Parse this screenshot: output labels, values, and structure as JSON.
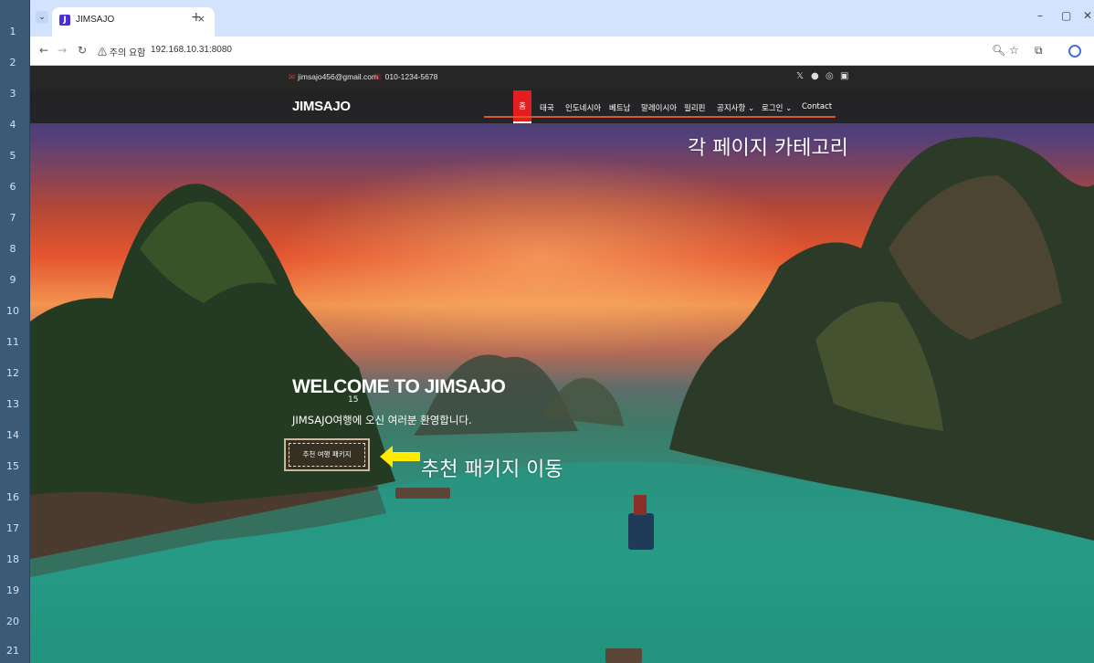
{
  "gutter": {
    "rows": [
      "1",
      "2",
      "3",
      "4",
      "5",
      "6",
      "7",
      "8",
      "9",
      "10",
      "11",
      "12",
      "13",
      "14",
      "15",
      "16",
      "17",
      "18",
      "19",
      "20",
      "21"
    ]
  },
  "browser": {
    "tab_title": "JIMSAJO",
    "tab_icon_letter": "J",
    "tab_close": "×",
    "new_tab": "+",
    "security_label": "⚠ 주의 요함",
    "url": "192.168.10.31:8080",
    "window_controls": [
      "–",
      "▢",
      "✕"
    ]
  },
  "site": {
    "topbar": {
      "email": "jimsajo456@gmail.com",
      "phone": "010-1234-5678",
      "social_icons": [
        "x-icon",
        "facebook-icon",
        "instagram-icon",
        "youtube-icon"
      ]
    },
    "navbar": {
      "brand": "JIMSAJO",
      "menu": [
        "홈",
        "태국",
        "인도네시아",
        "베트남",
        "말레이시아",
        "필리핀",
        "공지사항 ⌄",
        "로그인 ⌄",
        "Contact"
      ]
    },
    "hero": {
      "title": "WELCOME TO JIMSAJO",
      "page_number": "15",
      "subtitle": "JIMSAJO여행에 오신 여러분 환영합니다.",
      "button": "추천 여행 패키지"
    }
  },
  "annotations": {
    "categories_note": "각 페이지 카테고리",
    "package_note": "추천 패키지 이동",
    "accent_color": "#ffea00"
  }
}
